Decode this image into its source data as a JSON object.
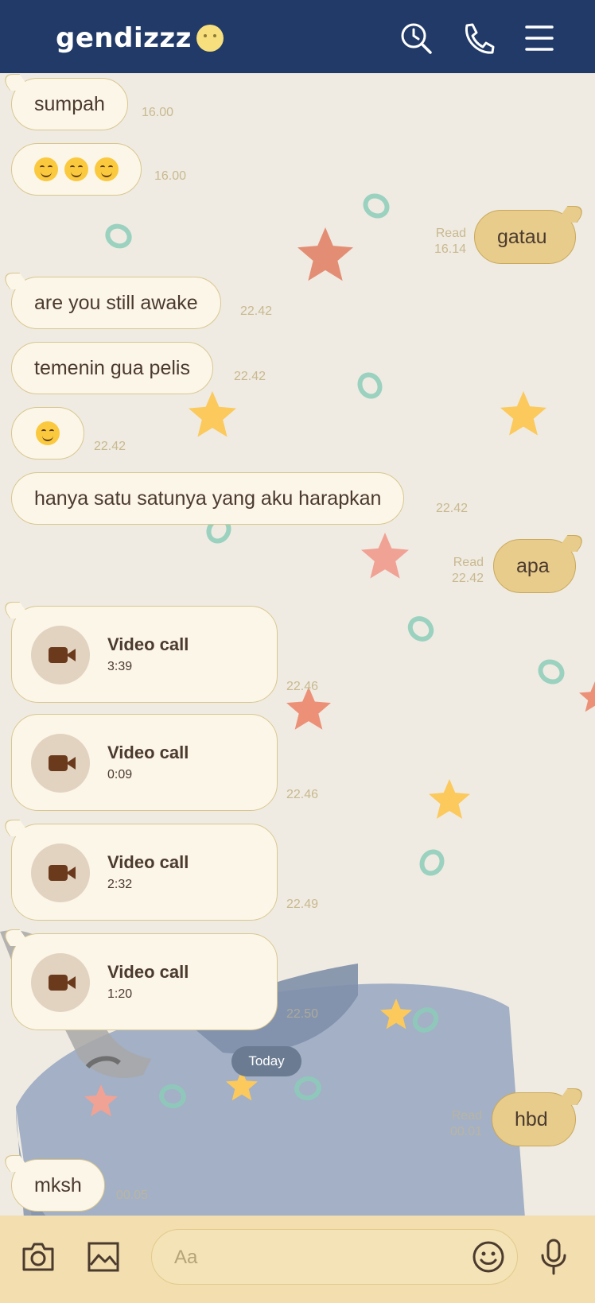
{
  "header": {
    "title": "gendizzz"
  },
  "messages": [
    {
      "text": "sumpah",
      "time": "16.00"
    },
    {
      "time": "16.00"
    },
    {
      "text": "gatau",
      "read": "Read",
      "time": "16.14"
    },
    {
      "text": "are you still awake",
      "time": "22.42"
    },
    {
      "text": "temenin gua pelis",
      "time": "22.42"
    },
    {
      "time": "22.42"
    },
    {
      "text": "hanya satu satunya yang aku harapkan",
      "time": "22.42"
    },
    {
      "text": "apa",
      "read": "Read",
      "time": "22.42"
    },
    {
      "title": "Video call",
      "duration": "3:39",
      "time": "22.46"
    },
    {
      "title": "Video call",
      "duration": "0:09",
      "time": "22.46"
    },
    {
      "title": "Video call",
      "duration": "2:32",
      "time": "22.49"
    },
    {
      "title": "Video call",
      "duration": "1:20",
      "time": "22.50"
    },
    {
      "text": "hbd",
      "read": "Read",
      "time": "00.01"
    },
    {
      "text": "mksh",
      "time": "00.05"
    }
  ],
  "date_divider": "Today",
  "composer": {
    "placeholder": "Aa"
  },
  "colors": {
    "header": "#213a68",
    "incoming_bubble": "#fcf6e8",
    "outgoing_bubble": "#e8cc8c",
    "footer": "#f2deae"
  },
  "icons": [
    "search-icon",
    "phone-icon",
    "menu-icon",
    "camera-icon",
    "image-icon",
    "emoji-icon",
    "microphone-icon",
    "video-camera-icon"
  ]
}
